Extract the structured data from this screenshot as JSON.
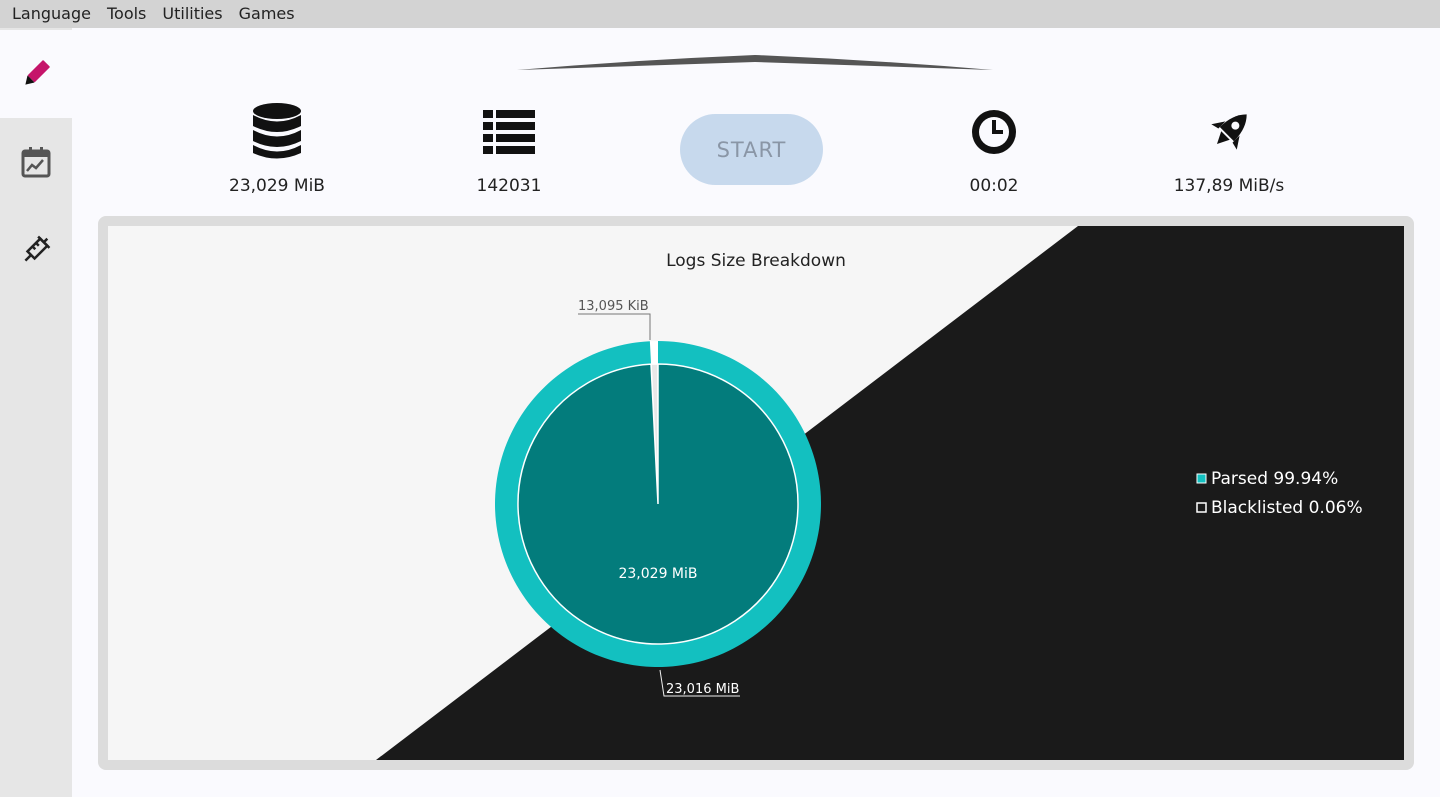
{
  "menubar": {
    "items": [
      "Language",
      "Tools",
      "Utilities",
      "Games"
    ]
  },
  "sidebar": {
    "items": [
      {
        "icon": "pencil-icon",
        "active": true
      },
      {
        "icon": "chart-calendar-icon",
        "active": false
      },
      {
        "icon": "syringe-icon",
        "active": false
      }
    ]
  },
  "stats": {
    "size": "23,029 MiB",
    "count": "142031",
    "time": "00:02",
    "speed": "137,89 MiB/s"
  },
  "start_label": "START",
  "colors": {
    "accent": "#c5146a",
    "parsed_outer": "#13c0c0",
    "parsed_inner": "#037c7c",
    "blacklisted": "#ffffff",
    "dark_bg": "#1a1a1a"
  },
  "chart_data": {
    "type": "pie",
    "title": "Logs Size Breakdown",
    "slices": [
      {
        "label": "Parsed 99.94%",
        "value": 23.016,
        "display": "23,016 MiB"
      },
      {
        "label": "Blacklisted 0.06%",
        "value": 0.013095,
        "display": "13,095 KiB"
      }
    ],
    "center_label": "23,029 MiB",
    "legend_position": "right"
  }
}
